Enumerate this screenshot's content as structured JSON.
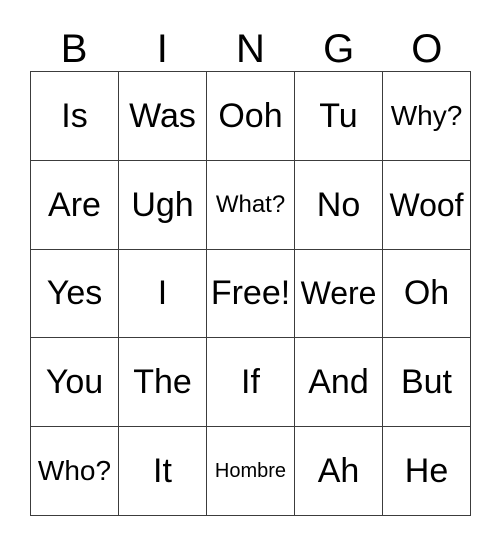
{
  "card": {
    "title": "BINGO",
    "headers": [
      "B",
      "I",
      "N",
      "G",
      "O"
    ],
    "free_space_label": "Free!",
    "colors": {
      "background": "#ffffff",
      "text": "#000000",
      "border": "#3c3c3c"
    },
    "rows": [
      [
        {
          "text": "Is",
          "size": "normal"
        },
        {
          "text": "Was",
          "size": "normal"
        },
        {
          "text": "Ooh",
          "size": "normal"
        },
        {
          "text": "Tu",
          "size": "normal"
        },
        {
          "text": "Why?",
          "size": "md"
        }
      ],
      [
        {
          "text": "Are",
          "size": "normal"
        },
        {
          "text": "Ugh",
          "size": "normal"
        },
        {
          "text": "What?",
          "size": "sm"
        },
        {
          "text": "No",
          "size": "normal"
        },
        {
          "text": "Woof",
          "size": "lg"
        }
      ],
      [
        {
          "text": "Yes",
          "size": "normal"
        },
        {
          "text": "I",
          "size": "normal"
        },
        {
          "text": "Free!",
          "size": "normal"
        },
        {
          "text": "Were",
          "size": "lg"
        },
        {
          "text": "Oh",
          "size": "normal"
        }
      ],
      [
        {
          "text": "You",
          "size": "normal"
        },
        {
          "text": "The",
          "size": "normal"
        },
        {
          "text": "If",
          "size": "normal"
        },
        {
          "text": "And",
          "size": "normal"
        },
        {
          "text": "But",
          "size": "normal"
        }
      ],
      [
        {
          "text": "Who?",
          "size": "md"
        },
        {
          "text": "It",
          "size": "normal"
        },
        {
          "text": "Hombre",
          "size": "xs"
        },
        {
          "text": "Ah",
          "size": "normal"
        },
        {
          "text": "He",
          "size": "normal"
        }
      ]
    ]
  }
}
